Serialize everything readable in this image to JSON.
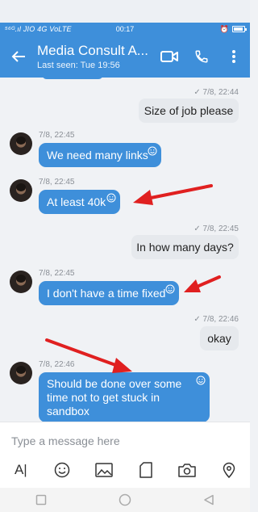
{
  "status": {
    "carrier": "⁵⁶ᴳ.ıl JIO 4G VoLTE",
    "time": "00:17",
    "battery_level": 0.9
  },
  "header": {
    "title": "Media Consult A...",
    "subtitle": "Last seen: Tue 19:56"
  },
  "messages": [
    {
      "dir": "out",
      "time": "7/8, 22:44",
      "text": "Size of job please"
    },
    {
      "dir": "in",
      "time": "7/8, 22:45",
      "text": "We need many links"
    },
    {
      "dir": "in",
      "time": "7/8, 22:45",
      "text": "At least 40k"
    },
    {
      "dir": "out",
      "time": "7/8, 22:45",
      "text": "In how many days?"
    },
    {
      "dir": "in",
      "time": "7/8, 22:45",
      "text": "I don't have a time fixed"
    },
    {
      "dir": "out",
      "time": "7/8, 22:46",
      "text": "okay"
    },
    {
      "dir": "in",
      "time": "7/8, 22:46",
      "text": "Should be done over some time not to get stuck in sandbox"
    }
  ],
  "composer": {
    "placeholder": "Type a message here"
  },
  "colors": {
    "accent": "#3e8fda",
    "annotation_arrow": "#e02020"
  }
}
